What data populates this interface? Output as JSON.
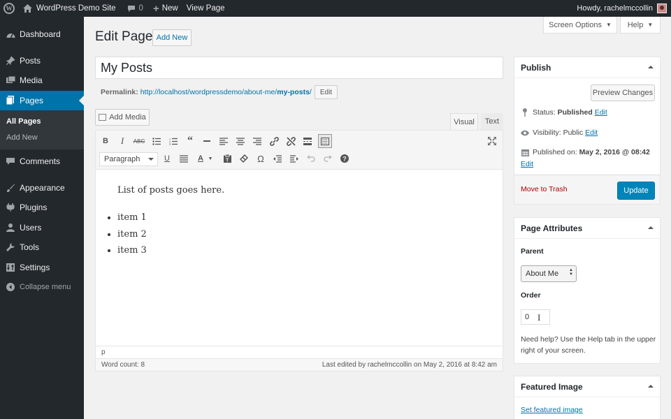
{
  "adminbar": {
    "site_name": "WordPress Demo Site",
    "comments_count": "0",
    "new_label": "New",
    "view_page": "View Page",
    "howdy": "Howdy, rachelmccollin"
  },
  "sidebar": {
    "items": [
      {
        "label": "Dashboard",
        "icon": "dashboard-icon"
      },
      {
        "label": "Posts",
        "icon": "pin-icon"
      },
      {
        "label": "Media",
        "icon": "media-icon"
      },
      {
        "label": "Pages",
        "icon": "page-icon"
      },
      {
        "label": "Comments",
        "icon": "comment-icon"
      },
      {
        "label": "Appearance",
        "icon": "brush-icon"
      },
      {
        "label": "Plugins",
        "icon": "plug-icon"
      },
      {
        "label": "Users",
        "icon": "users-icon"
      },
      {
        "label": "Tools",
        "icon": "wrench-icon"
      },
      {
        "label": "Settings",
        "icon": "settings-icon"
      }
    ],
    "submenu": [
      "All Pages",
      "Add New"
    ],
    "collapse": "Collapse menu"
  },
  "screen_options": "Screen Options",
  "help": "Help",
  "page": {
    "heading": "Edit Page",
    "add_new": "Add New",
    "title_value": "My Posts",
    "permalink_label": "Permalink:",
    "permalink_base": "http://localhost/wordpressdemo/about-me/",
    "permalink_slug": "my-posts",
    "permalink_end": "/",
    "permalink_edit": "Edit"
  },
  "editor": {
    "add_media": "Add Media",
    "tab_visual": "Visual",
    "tab_text": "Text",
    "format": "Paragraph",
    "content_paragraph": "List of posts goes here.",
    "content_items": [
      "item 1",
      "item 2",
      "item 3"
    ],
    "path": "p",
    "word_count": "Word count: 8",
    "last_edited": "Last edited by rachelmccollin on May 2, 2016 at 8:42 am"
  },
  "publish": {
    "title": "Publish",
    "preview": "Preview Changes",
    "status_label": "Status:",
    "status_value": "Published",
    "visibility_label": "Visibility:",
    "visibility_value": "Public",
    "published_label": "Published on:",
    "published_value": "May 2, 2016 @ 08:42",
    "edit": "Edit",
    "trash": "Move to Trash",
    "update": "Update"
  },
  "attributes": {
    "title": "Page Attributes",
    "parent_label": "Parent",
    "parent_value": "About Me",
    "order_label": "Order",
    "order_value": "0",
    "help": "Need help? Use the Help tab in the upper right of your screen."
  },
  "featured": {
    "title": "Featured Image",
    "link": "Set featured image"
  },
  "colors": {
    "admin_dark": "#23282d",
    "accent": "#0073aa",
    "primary_button": "#0085ba",
    "trash": "#a00"
  }
}
